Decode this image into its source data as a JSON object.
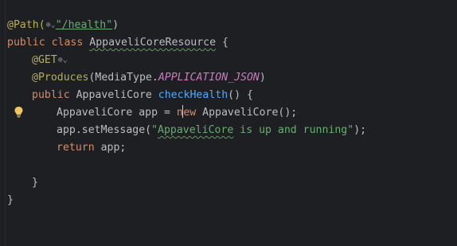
{
  "code": {
    "line1": {
      "annotation": "@Path(",
      "inlay": "⊕⌄",
      "string": "\"/health\"",
      "close": ")"
    },
    "line2": {
      "kw1": "public",
      "kw2": "class",
      "class_name": "AppaveliCoreResource",
      "brace": " {"
    },
    "line3": {
      "annotation": "@GET",
      "inlay": "⊕⌄"
    },
    "line4": {
      "annotation": "@Produces",
      "open": "(MediaType.",
      "const": "APPLICATION_JSON",
      "close": ")"
    },
    "line5": {
      "kw": "public",
      "type": " AppaveliCore ",
      "method": "checkHealth",
      "rest": "() {"
    },
    "line6": {
      "before": "AppaveliCore app = ",
      "kw_a": "n",
      "kw_b": "ew",
      "after": " AppaveliCore();"
    },
    "line7": {
      "before": "app.setMessage(",
      "str_q": "\"",
      "str_word": "AppaveliCore",
      "str_rest": " is up and running\"",
      "after": ");"
    },
    "line8": {
      "kw": "return",
      "after": " app;"
    },
    "line10": {
      "brace": "}"
    },
    "line11": {
      "brace": "}"
    }
  },
  "icons": {
    "intention": "lightbulb-icon",
    "globe": "globe-icon"
  },
  "colors": {
    "background": "#1e1f22",
    "text": "#bcbec4",
    "keyword": "#cf8e6d",
    "annotation": "#b3ae60",
    "string": "#6aab73",
    "constant": "#c77dbb",
    "method": "#56a8f5",
    "bulb": "#f2c55c"
  }
}
